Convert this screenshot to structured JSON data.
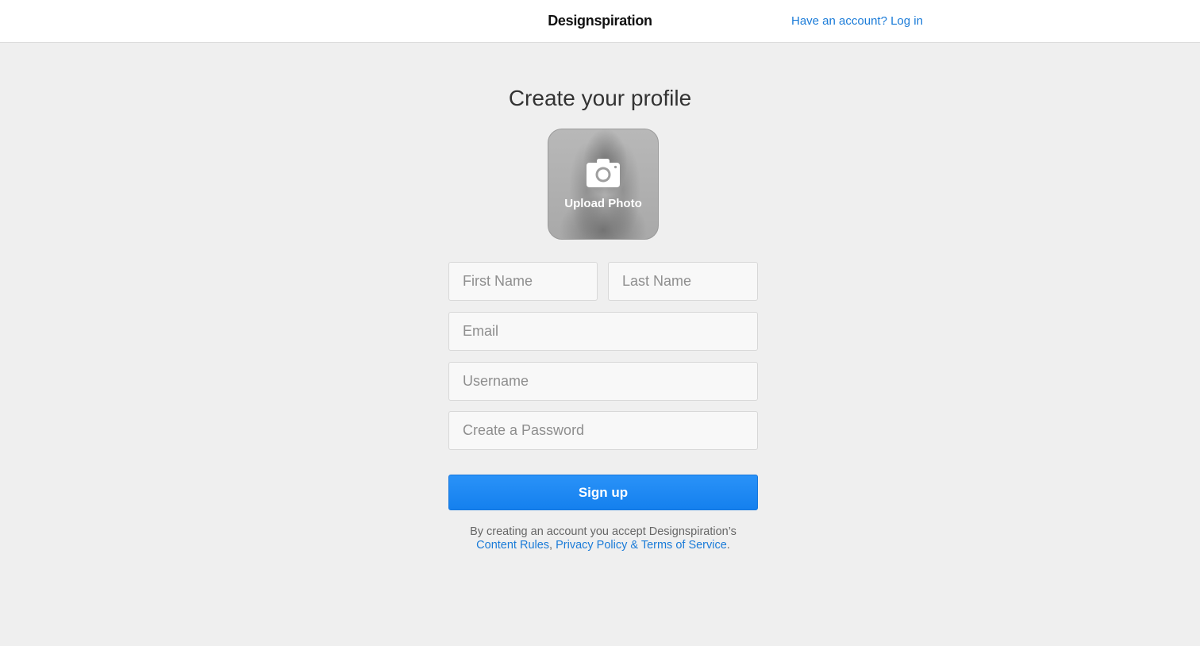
{
  "header": {
    "logo": "Designspiration",
    "login_link": "Have an account? Log in"
  },
  "main": {
    "title": "Create your profile",
    "upload": {
      "label": "Upload Photo",
      "icon": "camera-icon"
    },
    "fields": {
      "first_name": {
        "placeholder": "First Name",
        "value": ""
      },
      "last_name": {
        "placeholder": "Last Name",
        "value": ""
      },
      "email": {
        "placeholder": "Email",
        "value": ""
      },
      "username": {
        "placeholder": "Username",
        "value": ""
      },
      "password": {
        "placeholder": "Create a Password",
        "value": ""
      }
    },
    "signup_label": "Sign up",
    "terms": {
      "prefix": "By creating an account you accept Designspiration’s",
      "content_rules": "Content Rules",
      "separator": ", ",
      "privacy_terms": "Privacy Policy & Terms of Service",
      "suffix": "."
    }
  },
  "colors": {
    "accent": "#1a7bd8",
    "button": "#1480ee",
    "background": "#efefef",
    "header_bg": "#ffffff"
  }
}
